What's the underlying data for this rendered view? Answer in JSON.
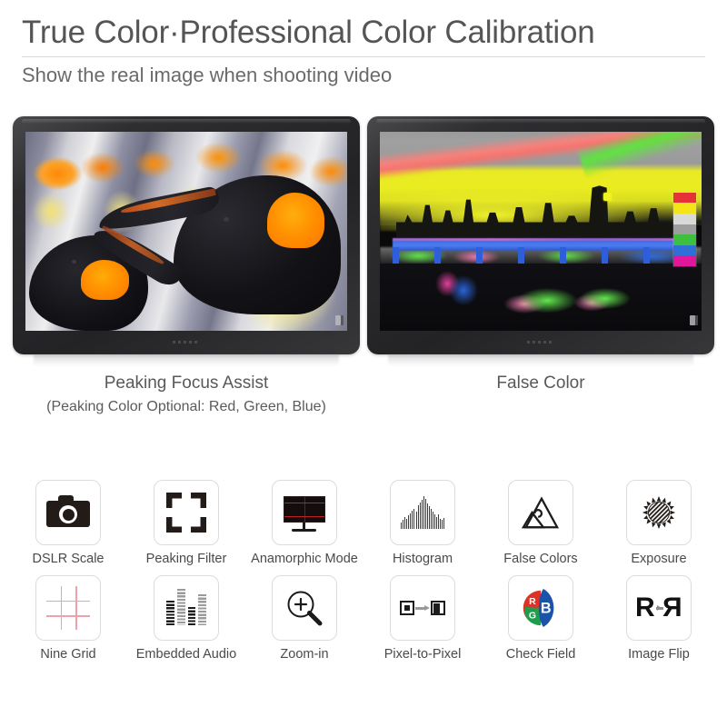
{
  "header": {
    "title": "True Color·Professional Color Calibration",
    "subtitle": "Show the real image when shooting video"
  },
  "monitors": [
    {
      "id": "peaking-focus-assist",
      "screen_content": "king-penguins-photo",
      "caption": "Peaking Focus Assist",
      "caption_sub": "(Peaking Color Optional: Red, Green, Blue)"
    },
    {
      "id": "false-color",
      "screen_content": "london-skyline-false-color",
      "caption": "False Color",
      "caption_sub": ""
    }
  ],
  "false_color_scale": [
    "#e53238",
    "#f4e519",
    "#d9d9d9",
    "#9e9e9e",
    "#3fbf3f",
    "#2f6fd8",
    "#e0179b"
  ],
  "features": [
    {
      "label": "DSLR Scale",
      "icon": "dslr-camera-icon"
    },
    {
      "label": "Peaking Filter",
      "icon": "focus-brackets-icon"
    },
    {
      "label": "Anamorphic Mode",
      "icon": "monitor-crosshair-icon"
    },
    {
      "label": "Histogram",
      "icon": "histogram-bars-icon"
    },
    {
      "label": "False Colors",
      "icon": "mountains-icon"
    },
    {
      "label": "Exposure",
      "icon": "sun-rays-icon"
    },
    {
      "label": "Nine Grid",
      "icon": "nine-grid-icon"
    },
    {
      "label": "Embedded Audio",
      "icon": "audio-equalizer-icon"
    },
    {
      "label": "Zoom-in",
      "icon": "magnifier-plus-icon"
    },
    {
      "label": "Pixel-to-Pixel",
      "icon": "pixel-mapping-arrow-icon"
    },
    {
      "label": "Check Field",
      "icon": "rgb-circle-icon"
    },
    {
      "label": "Image Flip",
      "icon": "mirror-r-icon"
    }
  ],
  "check_field": {
    "r_label": "R",
    "g_label": "G",
    "b_label": "B",
    "r_color": "#e03127",
    "g_color": "#1f9d4d",
    "b_color": "#1a53a8"
  },
  "image_flip": {
    "left_char": "R",
    "right_char": "R"
  },
  "histogram_bars": [
    20,
    26,
    34,
    30,
    40,
    46,
    54,
    60,
    52,
    70,
    78,
    86,
    96,
    88,
    76,
    66,
    58,
    50,
    42,
    36,
    44,
    30,
    26,
    32
  ],
  "equalizer_bars": [
    62,
    92,
    46,
    78
  ],
  "colors": {
    "title": "#555555",
    "body_text": "#595959",
    "tile_border": "#dcdcdc",
    "accent_red": "#d0222a",
    "grid_pink": "#f0a0a8",
    "background": "#ffffff"
  }
}
